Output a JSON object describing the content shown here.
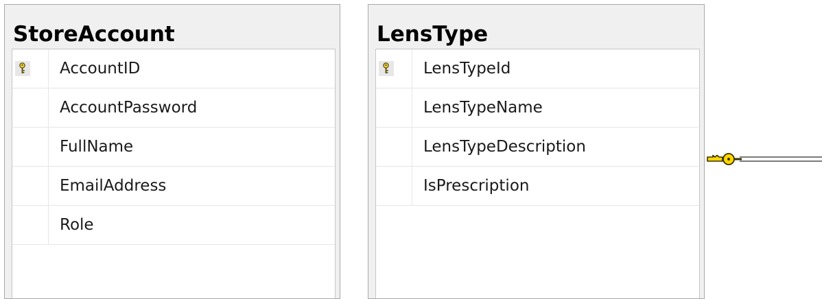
{
  "tables": [
    {
      "name": "StoreAccount",
      "columns": [
        {
          "name": "AccountID",
          "primary_key": true
        },
        {
          "name": "AccountPassword",
          "primary_key": false
        },
        {
          "name": "FullName",
          "primary_key": false
        },
        {
          "name": "EmailAddress",
          "primary_key": false
        },
        {
          "name": "Role",
          "primary_key": false
        }
      ]
    },
    {
      "name": "LensType",
      "columns": [
        {
          "name": "LensTypeId",
          "primary_key": true
        },
        {
          "name": "LensTypeName",
          "primary_key": false
        },
        {
          "name": "LensTypeDescription",
          "primary_key": false
        },
        {
          "name": "IsPrescription",
          "primary_key": false
        }
      ]
    }
  ],
  "relationship": {
    "from_table": "LensType",
    "key_icon": "foreign-key-icon",
    "color": "#ffd700"
  },
  "colors": {
    "table_header_bg": "#f0f0f0",
    "table_border": "#a8a8a8",
    "pk_icon": "#c8a200"
  }
}
